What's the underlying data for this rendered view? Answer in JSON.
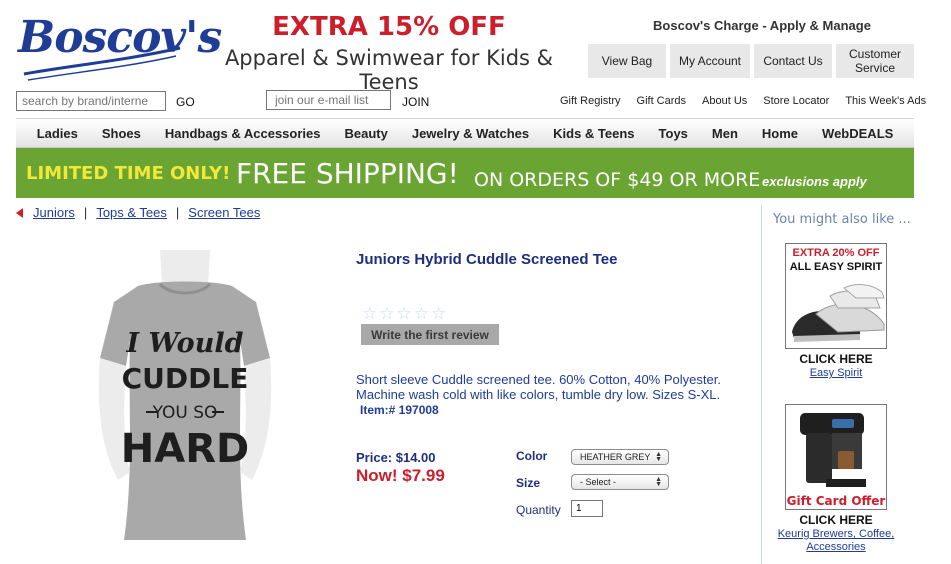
{
  "brand": {
    "logo_text": "Boscov's"
  },
  "promo": {
    "line1": "EXTRA 15% OFF",
    "line2": "Apparel & Swimwear for Kids & Teens"
  },
  "header": {
    "charge": "Boscov's Charge - Apply & Manage",
    "nav": [
      "View Bag",
      "My Account",
      "Contact Us",
      "Customer Service"
    ]
  },
  "search": {
    "placeholder": "search by brand/interne",
    "go": "GO"
  },
  "email": {
    "placeholder": "join our e-mail list",
    "join": "JOIN"
  },
  "utility": [
    "Gift Registry",
    "Gift Cards",
    "About Us",
    "Store Locator",
    "This Week's Ads"
  ],
  "categories": [
    "Ladies",
    "Shoes",
    "Handbags & Accessories",
    "Beauty",
    "Jewelry & Watches",
    "Kids & Teens",
    "Toys",
    "Men",
    "Home",
    "WebDEALS"
  ],
  "shipping": {
    "a": "LIMITED TIME ONLY!",
    "b": "FREE SHIPPING!",
    "c": "ON ORDERS OF $49 OR MORE",
    "d": "exclusions apply"
  },
  "breadcrumb": [
    "Juniors",
    "Tops & Tees",
    "Screen Tees"
  ],
  "product": {
    "title": "Juniors Hybrid Cuddle Screened Tee",
    "review_button": "Write the first review",
    "description": "Short sleeve Cuddle screened tee. 60% Cotton, 40% Polyester. Machine wash cold with like colors, tumble dry low. Sizes S-XL.",
    "item_number": "Item:# 197008",
    "price": "Price: $14.00",
    "now": "Now! $7.99",
    "shirt_text": [
      "I Would",
      "CUDDLE",
      "YOU SO",
      "HARD"
    ],
    "options": {
      "color_label": "Color",
      "color_value": "HEATHER GREY",
      "size_label": "Size",
      "size_value": "- Select -",
      "quantity_label": "Quantity",
      "quantity_value": "1"
    },
    "rating_stars": 0,
    "rating_max": 5
  },
  "sidebar": {
    "heading": "You might also like ...",
    "ad1": {
      "headline": "EXTRA 20% OFF",
      "subline": "ALL EASY SPIRIT",
      "cta": "CLICK HERE",
      "link": "Easy Spirit"
    },
    "ad2": {
      "headline": "Gift Card Offer",
      "cta": "CLICK HERE",
      "link": "Keurig Brewers, Coffee, Accessories"
    }
  },
  "colors": {
    "brand_blue": "#1f3c96",
    "promo_red": "#cc1f2b",
    "banner_green": "#6aa533",
    "banner_yellow": "#f2e83a"
  }
}
